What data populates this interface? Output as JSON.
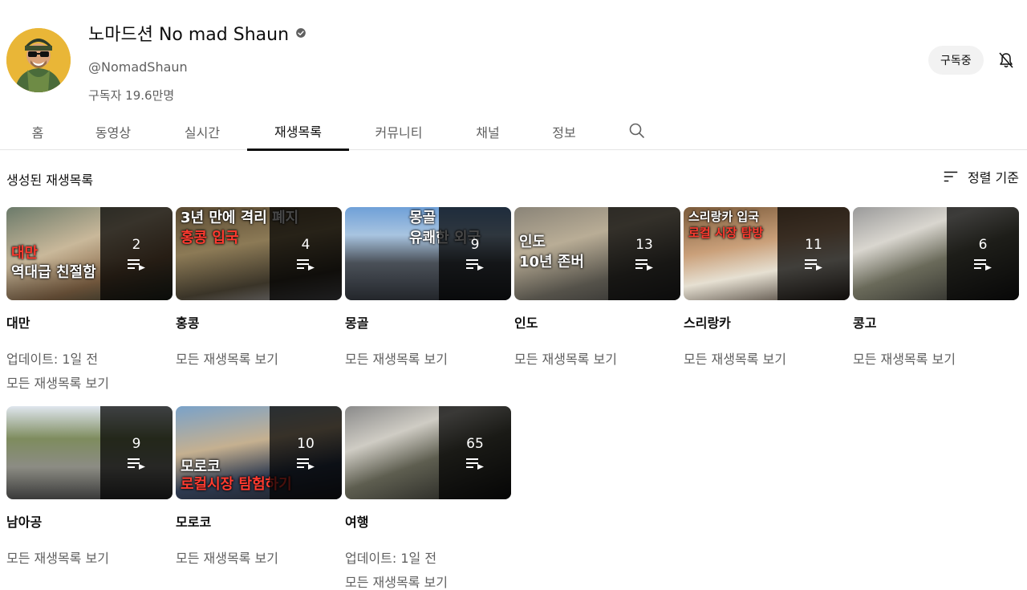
{
  "channel": {
    "name": "노마드션 No mad Shaun",
    "handle": "@NomadShaun",
    "subscribers": "구독자 19.6만명",
    "subscribe_label": "구독중"
  },
  "tabs": [
    {
      "label": "홈"
    },
    {
      "label": "동영상"
    },
    {
      "label": "실시간"
    },
    {
      "label": "재생목록"
    },
    {
      "label": "커뮤니티"
    },
    {
      "label": "채널"
    },
    {
      "label": "정보"
    }
  ],
  "section": {
    "title": "생성된 재생목록",
    "sort_label": "정렬 기준"
  },
  "playlists": [
    {
      "title": "대만",
      "count": "2",
      "updated": "업데이트: 1일 전",
      "link": "모든 재생목록 보기",
      "caption1": "대만",
      "caption2": "역대급 친절함"
    },
    {
      "title": "홍콩",
      "count": "4",
      "updated": "",
      "link": "모든 재생목록 보기",
      "caption1": "3년 만에 격리 폐지",
      "caption2": "홍콩 입국"
    },
    {
      "title": "몽골",
      "count": "9",
      "updated": "",
      "link": "모든 재생목록 보기",
      "caption1": "몽골",
      "caption2": "유쾌한 외국"
    },
    {
      "title": "인도",
      "count": "13",
      "updated": "",
      "link": "모든 재생목록 보기",
      "caption1": "인도",
      "caption2": "10년 존버"
    },
    {
      "title": "스리랑카",
      "count": "11",
      "updated": "",
      "link": "모든 재생목록 보기",
      "caption1": "스리랑카 입국",
      "caption2": "로컬 시장 탐방"
    },
    {
      "title": "콩고",
      "count": "6",
      "updated": "",
      "link": "모든 재생목록 보기",
      "caption1": "",
      "caption2": ""
    },
    {
      "title": "남아공",
      "count": "9",
      "updated": "",
      "link": "모든 재생목록 보기",
      "caption1": "",
      "caption2": ""
    },
    {
      "title": "모로코",
      "count": "10",
      "updated": "",
      "link": "모든 재생목록 보기",
      "caption1": "모로코",
      "caption2": "로컬시장 탐험하기"
    },
    {
      "title": "여행",
      "count": "65",
      "updated": "업데이트: 1일 전",
      "link": "모든 재생목록 보기",
      "caption1": "",
      "caption2": ""
    }
  ],
  "colors": {
    "accent": "#0f0f0f",
    "muted": "#606060",
    "chip": "#f2f2f2"
  },
  "icons": [
    "verified-icon",
    "bell-off-icon",
    "search-icon",
    "sort-icon",
    "playlist-icon"
  ]
}
